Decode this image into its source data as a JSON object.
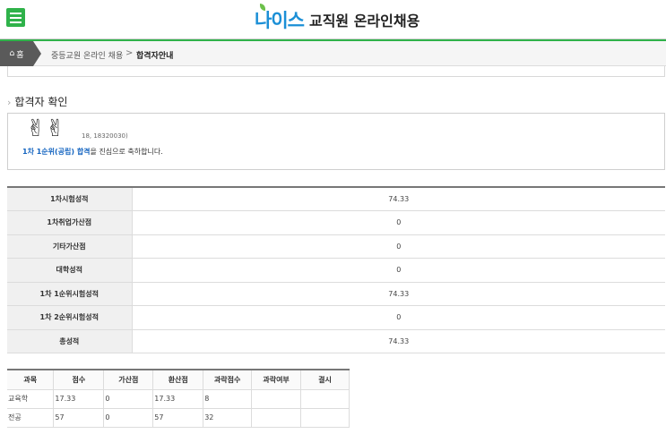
{
  "header": {
    "logo_neis": "나이스",
    "logo_title": "교직원 온라인채용"
  },
  "breadcrumb": {
    "home": "홈",
    "level1": "중등교원 온라인 채용",
    "separator": ">",
    "current": "합격자안내"
  },
  "section": {
    "title": "합격자 확인"
  },
  "result": {
    "emoji": "✌",
    "id_text": "18, 18320030)",
    "pass_highlight": "1차 1순위(공립) 합격",
    "pass_suffix": "을 진심으로 축하합니다."
  },
  "scores": [
    {
      "label": "1차시험성적",
      "value": "74.33"
    },
    {
      "label": "1차취업가산점",
      "value": "0"
    },
    {
      "label": "기타가산점",
      "value": "0"
    },
    {
      "label": "대학성적",
      "value": "0"
    },
    {
      "label": "1차 1순위시험성적",
      "value": "74.33"
    },
    {
      "label": "1차 2순위시험성적",
      "value": "0"
    },
    {
      "label": "총성적",
      "value": "74.33"
    }
  ],
  "subject_table": {
    "headers": [
      "과목",
      "점수",
      "가산점",
      "환산점",
      "과락점수",
      "과락여부",
      "결시"
    ],
    "rows": [
      [
        "교육학",
        "17.33",
        "0",
        "17.33",
        "8",
        "",
        ""
      ],
      [
        "전공",
        "57",
        "0",
        "57",
        "32",
        "",
        ""
      ]
    ]
  },
  "colors": {
    "brand_green": "#2fb24a",
    "brand_blue": "#1b8fd6",
    "highlight_blue": "#1565c0"
  }
}
